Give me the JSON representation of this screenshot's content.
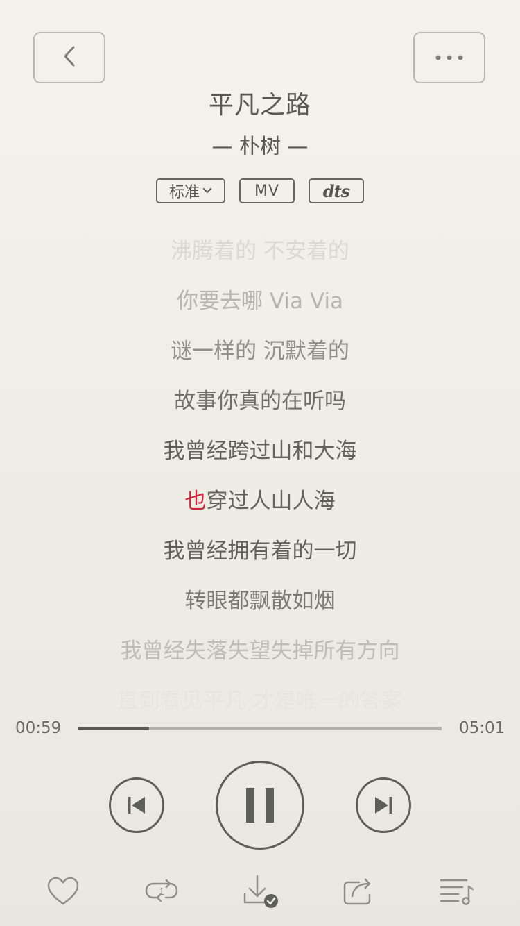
{
  "song": {
    "title": "平凡之路",
    "artist_line": "— 朴树 —"
  },
  "chips": {
    "quality_label": "标准",
    "mv_label": "MV",
    "dts_label": "dts"
  },
  "lyrics": {
    "lines": [
      {
        "text": "沸腾着的 不安着的",
        "color": "#d9d8d2"
      },
      {
        "text": "你要去哪 Via Via",
        "color": "#b6b5ae"
      },
      {
        "text": "谜一样的 沉默着的",
        "color": "#8f8e88"
      },
      {
        "text": "故事你真的在听吗",
        "color": "#6f6e68"
      },
      {
        "text": "我曾经跨过山和大海",
        "color": "#636259"
      },
      {
        "text": "也穿过人山人海",
        "color": "#636259",
        "current": true,
        "played": "也",
        "rest": "穿过人山人海"
      },
      {
        "text": "我曾经拥有着的一切",
        "color": "#636259"
      },
      {
        "text": "转眼都飘散如烟",
        "color": "#7b7a74"
      },
      {
        "text": "我曾经失落失望失掉所有方向",
        "color": "#bdbcb5"
      },
      {
        "text": "直到看见平凡 才是唯一的答案",
        "color": "#e6e5df"
      }
    ]
  },
  "progress": {
    "current_time": "00:59",
    "total_time": "05:01",
    "fraction": 0.196
  },
  "controls": {
    "prev_icon": "skip-previous-icon",
    "pause_icon": "pause-icon",
    "next_icon": "skip-next-icon"
  },
  "bottom_bar": {
    "like_icon": "heart-icon",
    "loop_icon": "repeat-one-icon",
    "loop_badge": "1",
    "download_icon": "download-done-icon",
    "share_icon": "share-icon",
    "playlist_icon": "playlist-icon"
  },
  "colors": {
    "accent": "#c8243b",
    "icon": "#5f5f59",
    "icon_light": "#8f8e88"
  }
}
